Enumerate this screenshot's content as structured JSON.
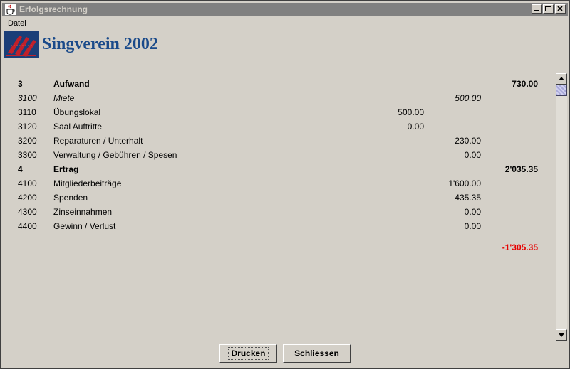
{
  "window": {
    "title": "Erfolgsrechnung",
    "controls": [
      "minimize",
      "maximize",
      "close"
    ]
  },
  "menu": {
    "items": [
      "Datei"
    ]
  },
  "header": {
    "app_title": "Singverein 2002",
    "logo_icon": "singverein-logo-icon"
  },
  "report": {
    "rows": [
      {
        "num": "3",
        "desc": "Aufwand",
        "v1": "",
        "v2": "",
        "v3": "730.00",
        "style": "bold"
      },
      {
        "num": "3100",
        "desc": "Miete",
        "v1": "",
        "v2": "500.00",
        "v3": "",
        "style": "italic"
      },
      {
        "num": "3110",
        "desc": "Übungslokal",
        "v1": "500.00",
        "v2": "",
        "v3": "",
        "style": "normal"
      },
      {
        "num": "3120",
        "desc": "Saal Auftritte",
        "v1": "0.00",
        "v2": "",
        "v3": "",
        "style": "normal"
      },
      {
        "num": "3200",
        "desc": "Reparaturen / Unterhalt",
        "v1": "",
        "v2": "230.00",
        "v3": "",
        "style": "normal"
      },
      {
        "num": "3300",
        "desc": "Verwaltung / Gebühren / Spesen",
        "v1": "",
        "v2": "0.00",
        "v3": "",
        "style": "normal"
      },
      {
        "num": "4",
        "desc": "Ertrag",
        "v1": "",
        "v2": "",
        "v3": "2'035.35",
        "style": "bold"
      },
      {
        "num": "4100",
        "desc": "Mitgliederbeiträge",
        "v1": "",
        "v2": "1'600.00",
        "v3": "",
        "style": "normal"
      },
      {
        "num": "4200",
        "desc": "Spenden",
        "v1": "",
        "v2": "435.35",
        "v3": "",
        "style": "normal"
      },
      {
        "num": "4300",
        "desc": "Zinseinnahmen",
        "v1": "",
        "v2": "0.00",
        "v3": "",
        "style": "normal"
      },
      {
        "num": "4400",
        "desc": "Gewinn / Verlust",
        "v1": "",
        "v2": "0.00",
        "v3": "",
        "style": "normal"
      }
    ],
    "result": "-1'305.35",
    "result_color": "#e60000"
  },
  "buttons": {
    "print_label": "Drucken",
    "close_label": "Schliessen"
  },
  "colors": {
    "background": "#d4d0c8",
    "titlebar_inactive": "#808080",
    "title_accent": "#1a4a8a"
  }
}
